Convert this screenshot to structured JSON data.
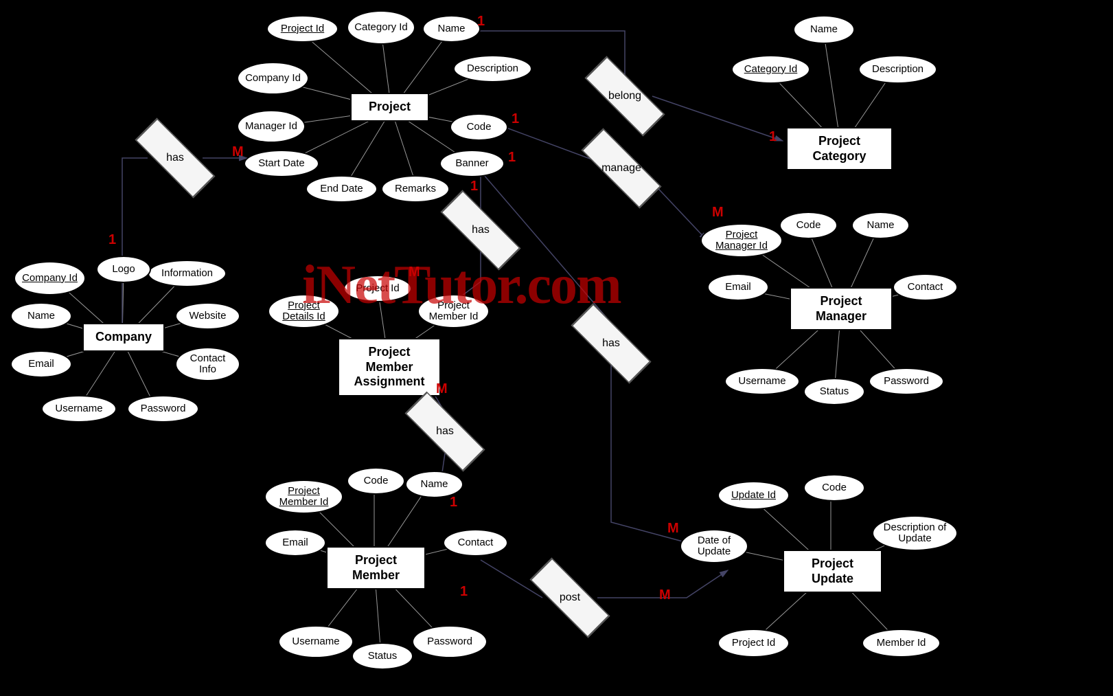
{
  "watermark": "iNetTutor.com",
  "entities": {
    "company": {
      "label": "Company",
      "attrs": {
        "company_id": "Company Id",
        "name": "Name",
        "email": "Email",
        "username": "Username",
        "password": "Password",
        "contact_info": "Contact Info",
        "website": "Website",
        "information": "Information",
        "logo": "Logo"
      }
    },
    "project": {
      "label": "Project",
      "attrs": {
        "project_id": "Project Id",
        "category_id": "Category Id",
        "name": "Name",
        "description": "Description",
        "code": "Code",
        "banner": "Banner",
        "remarks": "Remarks",
        "end_date": "End Date",
        "start_date": "Start Date",
        "manager_id": "Manager Id",
        "company_id": "Company Id"
      }
    },
    "project_category": {
      "label": "Project Category",
      "attrs": {
        "category_id": "Category Id",
        "name": "Name",
        "description": "Description"
      }
    },
    "project_manager": {
      "label": "Project Manager",
      "attrs": {
        "project_manager_id": "Project Manager Id",
        "code": "Code",
        "name": "Name",
        "contact": "Contact",
        "email": "Email",
        "username": "Username",
        "status": "Status",
        "password": "Password"
      }
    },
    "project_member_assignment": {
      "label": "Project Member Assignment",
      "attrs": {
        "project_details_id": "Project Details Id",
        "project_id": "Project Id",
        "project_member_id": "Project Member Id"
      }
    },
    "project_member": {
      "label": "Project Member",
      "attrs": {
        "project_member_id": "Project Member Id",
        "code": "Code",
        "name": "Name",
        "contact": "Contact",
        "email": "Email",
        "username": "Username",
        "status": "Status",
        "password": "Password"
      }
    },
    "project_update": {
      "label": "Project Update",
      "attrs": {
        "update_id": "Update Id",
        "code": "Code",
        "description_of_update": "Description of Update",
        "member_id": "Member Id",
        "project_id": "Project Id",
        "date_of_update": "Date of Update"
      }
    }
  },
  "relationships": {
    "has_company_project": "has",
    "belong": "belong",
    "manage": "manage",
    "has_project_pma": "has",
    "has_project_update": "has",
    "has_pma_member": "has",
    "post": "post"
  },
  "cardinalities": {
    "c1": "1",
    "c2": "M",
    "c3": "1",
    "c4": "1",
    "c5": "1",
    "c6": "M",
    "c7": "1",
    "c8": "1",
    "c9": "M",
    "c10": "M",
    "c11": "M",
    "c12": "1",
    "c13": "1",
    "c14": "M"
  }
}
